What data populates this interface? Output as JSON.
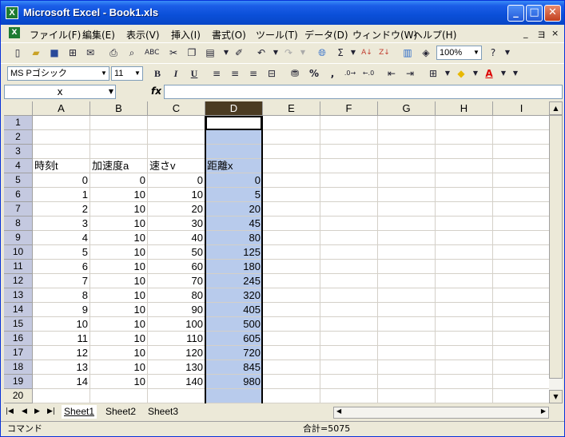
{
  "window": {
    "title": "Microsoft Excel - Book1.xls",
    "app_icon": "excel-icon",
    "min_label": "_",
    "max_label": "□",
    "close_label": "✕"
  },
  "menu": {
    "items": [
      "ファイル(F)",
      "編集(E)",
      "表示(V)",
      "挿入(I)",
      "書式(O)",
      "ツール(T)",
      "データ(D)",
      "ウィンドウ(W)",
      "ヘルプ(H)"
    ],
    "doc_min": "_",
    "doc_restore": "ヨ",
    "doc_close": "×"
  },
  "toolbar": {
    "zoom": "100%",
    "font_name": "MS Pゴシック",
    "font_size": "11",
    "bold": "B",
    "italic": "I",
    "underline": "U",
    "percent": "%",
    "comma": ",",
    "sigma": "Σ",
    "help": "?"
  },
  "formula_bar": {
    "name_box": "x",
    "fx": "fx",
    "formula": ""
  },
  "columns": [
    "A",
    "B",
    "C",
    "D",
    "E",
    "F",
    "G",
    "H",
    "I"
  ],
  "selected_column": "D",
  "rows": [
    {
      "n": "1",
      "cells": [
        "",
        "",
        "",
        ""
      ]
    },
    {
      "n": "2",
      "cells": [
        "",
        "",
        "",
        ""
      ]
    },
    {
      "n": "3",
      "cells": [
        "",
        "",
        "",
        ""
      ]
    },
    {
      "n": "4",
      "cells": [
        "時刻t",
        "加速度a",
        "速さv",
        "距離x"
      ]
    },
    {
      "n": "5",
      "cells": [
        "0",
        "0",
        "0",
        "0"
      ]
    },
    {
      "n": "6",
      "cells": [
        "1",
        "10",
        "10",
        "5"
      ]
    },
    {
      "n": "7",
      "cells": [
        "2",
        "10",
        "20",
        "20"
      ]
    },
    {
      "n": "8",
      "cells": [
        "3",
        "10",
        "30",
        "45"
      ]
    },
    {
      "n": "9",
      "cells": [
        "4",
        "10",
        "40",
        "80"
      ]
    },
    {
      "n": "10",
      "cells": [
        "5",
        "10",
        "50",
        "125"
      ]
    },
    {
      "n": "11",
      "cells": [
        "6",
        "10",
        "60",
        "180"
      ]
    },
    {
      "n": "12",
      "cells": [
        "7",
        "10",
        "70",
        "245"
      ]
    },
    {
      "n": "13",
      "cells": [
        "8",
        "10",
        "80",
        "320"
      ]
    },
    {
      "n": "14",
      "cells": [
        "9",
        "10",
        "90",
        "405"
      ]
    },
    {
      "n": "15",
      "cells": [
        "10",
        "10",
        "100",
        "500"
      ]
    },
    {
      "n": "16",
      "cells": [
        "11",
        "10",
        "110",
        "605"
      ]
    },
    {
      "n": "17",
      "cells": [
        "12",
        "10",
        "120",
        "720"
      ]
    },
    {
      "n": "18",
      "cells": [
        "13",
        "10",
        "130",
        "845"
      ]
    },
    {
      "n": "19",
      "cells": [
        "14",
        "10",
        "140",
        "980"
      ]
    },
    {
      "n": "20",
      "cells": [
        "",
        "",
        "",
        ""
      ]
    }
  ],
  "sheets": [
    "Sheet1",
    "Sheet2",
    "Sheet3"
  ],
  "active_sheet": "Sheet1",
  "status": {
    "mode": "コマンド",
    "sum": "合計=5075"
  }
}
